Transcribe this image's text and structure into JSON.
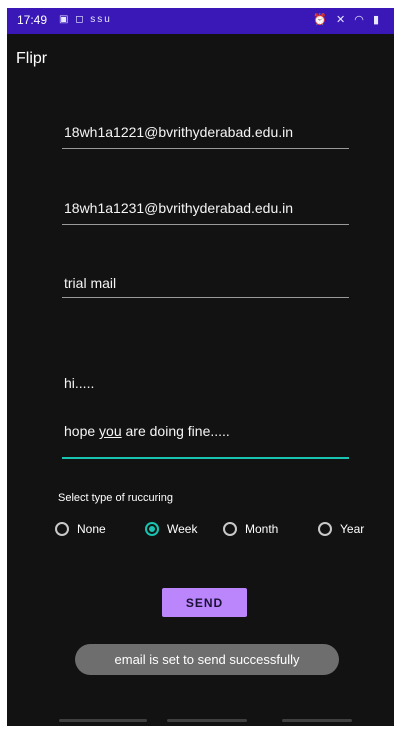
{
  "status": {
    "time": "17:49",
    "left_icons": "▣ ◻ ssu",
    "right_icons": "⏰ ✕ ◠ ▮"
  },
  "app": {
    "title": "Flipr"
  },
  "form": {
    "to": "18wh1a1221@bvrithyderabad.edu.in",
    "cc": "18wh1a1231@bvrithyderabad.edu.in",
    "subject": "trial mail",
    "body_line1": "hi.....",
    "body_line2_pre": "hope ",
    "body_line2_underlined": "you",
    "body_line2_post": " are doing fine....."
  },
  "recurrence": {
    "label": "Select type of ruccuring",
    "options": [
      {
        "label": "None",
        "checked": false
      },
      {
        "label": "Week",
        "checked": true
      },
      {
        "label": "Month",
        "checked": false
      },
      {
        "label": "Year",
        "checked": false
      }
    ]
  },
  "send_label": "SEND",
  "toast": "email is set to send successfully",
  "colors": {
    "status_bar": "#3a18b8",
    "accent": "#19c3b1",
    "button": "#bb86fc",
    "background": "#121212"
  }
}
